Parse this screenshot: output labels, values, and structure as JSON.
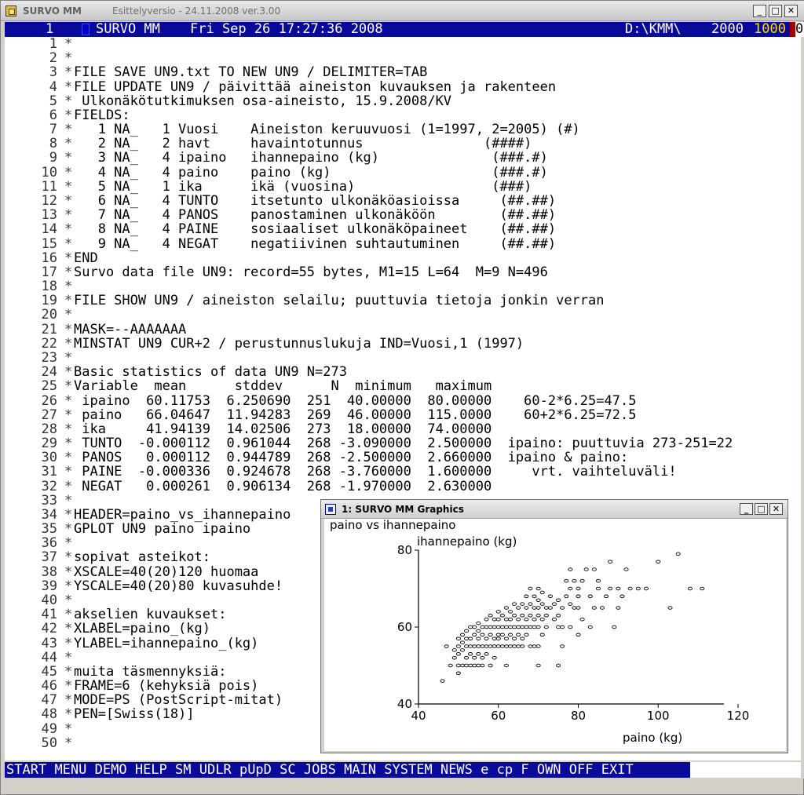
{
  "window": {
    "app_title": "SURVO MM",
    "subtitle": "Esittelyversio  - 24.11.2008 ver.3.00",
    "buttons": [
      "_",
      "□",
      "✕"
    ]
  },
  "status": {
    "line": "1",
    "program": "SURVO MM",
    "datetime": "Fri Sep 26 17:27:36 2008",
    "path": "D:\\KMM\\",
    "num1": "2000",
    "num2": "1000",
    "last": "0"
  },
  "lines": [
    {
      "n": "1",
      "c": "*",
      "t": ""
    },
    {
      "n": "2",
      "c": "*",
      "t": ""
    },
    {
      "n": "3",
      "c": "*",
      "t": "FILE SAVE UN9.txt TO NEW UN9 / DELIMITER=TAB"
    },
    {
      "n": "4",
      "c": "*",
      "t": "FILE UPDATE UN9 / päivittää aineiston kuvauksen ja rakenteen"
    },
    {
      "n": "5",
      "c": "*",
      "t": " Ulkonäkötutkimuksen osa-aineisto, 15.9.2008/KV"
    },
    {
      "n": "6",
      "c": "*",
      "t": "FIELDS:"
    },
    {
      "n": "7",
      "c": "*",
      "t": "   1 NA_   1 Vuosi    Aineiston keruuvuosi (1=1997, 2=2005) (#)"
    },
    {
      "n": "8",
      "c": "*",
      "t": "   2 NA_   2 havt     havaintotunnus               (####)"
    },
    {
      "n": "9",
      "c": "*",
      "t": "   3 NA_   4 ipaino   ihannepaino (kg)              (###.#)"
    },
    {
      "n": "10",
      "c": "*",
      "t": "   4 NA_   4 paino    paino (kg)                    (###.#)"
    },
    {
      "n": "11",
      "c": "*",
      "t": "   5 NA_   1 ika      ikä (vuosina)                 (###)"
    },
    {
      "n": "12",
      "c": "*",
      "t": "   6 NA_   4 TUNTO    itsetunto ulkonäköasioissa     (##.##)"
    },
    {
      "n": "13",
      "c": "*",
      "t": "   7 NA_   4 PANOS    panostaminen ulkonäköön        (##.##)"
    },
    {
      "n": "14",
      "c": "*",
      "t": "   8 NA_   4 PAINE    sosiaaliset ulkonäköpaineet    (##.##)"
    },
    {
      "n": "15",
      "c": "*",
      "t": "   9 NA_   4 NEGAT    negatiivinen suhtautuminen     (##.##)"
    },
    {
      "n": "16",
      "c": "*",
      "t": "END"
    },
    {
      "n": "17",
      "c": "*",
      "t": "Survo data file UN9: record=55 bytes, M1=15 L=64  M=9 N=496"
    },
    {
      "n": "18",
      "c": "*",
      "t": ""
    },
    {
      "n": "19",
      "c": "*",
      "t": "FILE SHOW UN9 / aineiston selailu; puuttuvia tietoja jonkin verran"
    },
    {
      "n": "20",
      "c": "*",
      "t": ""
    },
    {
      "n": "21",
      "c": "*",
      "t": "MASK=--AAAAAAA"
    },
    {
      "n": "22",
      "c": "*",
      "t": "MINSTAT UN9 CUR+2 / perustunnuslukuja IND=Vuosi,1 (1997)"
    },
    {
      "n": "23",
      "c": "*",
      "t": ""
    },
    {
      "n": "24",
      "c": "*",
      "t": "Basic statistics of data UN9 N=273"
    },
    {
      "n": "25",
      "c": "*",
      "t": "Variable  mean      stddev      N  minimum   maximum"
    },
    {
      "n": "26",
      "c": "*",
      "t": " ipaino  60.11753  6.250690  251  40.00000  80.00000    60-2*6.25=47.5"
    },
    {
      "n": "27",
      "c": "*",
      "t": " paino   66.04647  11.94283  269  46.00000  115.0000    60+2*6.25=72.5"
    },
    {
      "n": "28",
      "c": "*",
      "t": " ika     41.94139  14.02506  273  18.00000  74.00000"
    },
    {
      "n": "29",
      "c": "*",
      "t": " TUNTO  -0.000112  0.961044  268 -3.090000  2.500000  ipaino: puuttuvia 273-251=22"
    },
    {
      "n": "30",
      "c": "*",
      "t": " PANOS   0.000112  0.944789  268 -2.500000  2.660000  ipaino & paino:"
    },
    {
      "n": "31",
      "c": "*",
      "t": " PAINE  -0.000336  0.924678  268 -3.760000  1.600000     vrt. vaihteluväli!"
    },
    {
      "n": "32",
      "c": "*",
      "t": " NEGAT   0.000261  0.906134  268 -1.970000  2.630000"
    },
    {
      "n": "33",
      "c": "*",
      "t": ""
    },
    {
      "n": "34",
      "c": "*",
      "t": "HEADER=paino_vs_ihannepaino"
    },
    {
      "n": "35",
      "c": "*",
      "t": "GPLOT UN9 paino ipaino"
    },
    {
      "n": "36",
      "c": "*",
      "t": ""
    },
    {
      "n": "37",
      "c": "*",
      "t": "sopivat asteikot:"
    },
    {
      "n": "38",
      "c": "*",
      "t": "XSCALE=40(20)120 huomaa"
    },
    {
      "n": "39",
      "c": "*",
      "t": "YSCALE=40(20)80 kuvasuhde!"
    },
    {
      "n": "40",
      "c": "*",
      "t": ""
    },
    {
      "n": "41",
      "c": "*",
      "t": "akselien kuvaukset:"
    },
    {
      "n": "42",
      "c": "*",
      "t": "XLABEL=paino_(kg)"
    },
    {
      "n": "43",
      "c": "*",
      "t": "YLABEL=ihannepaino_(kg)"
    },
    {
      "n": "44",
      "c": "*",
      "t": ""
    },
    {
      "n": "45",
      "c": "*",
      "t": "muita täsmennyksiä:"
    },
    {
      "n": "46",
      "c": "*",
      "t": "FRAME=6 (kehyksiä pois)"
    },
    {
      "n": "47",
      "c": "*",
      "t": "MODE=PS (PostScript-mitat)"
    },
    {
      "n": "48",
      "c": "*",
      "t": "PEN=[Swiss(18)]"
    },
    {
      "n": "49",
      "c": "*",
      "t": ""
    },
    {
      "n": "50",
      "c": "*",
      "t": ""
    }
  ],
  "keys": [
    "START",
    "MENU",
    "DEMO",
    "HELP",
    "SM",
    "UDLR",
    "pUpD",
    "SC",
    "JOBS",
    "MAIN",
    "SYSTEM",
    "NEWS",
    "e",
    "cp",
    "F",
    "OWN",
    "OFF",
    "EXIT"
  ],
  "graphics_window": {
    "title": "1: SURVO MM  Graphics",
    "buttons": [
      "_",
      "□",
      "✕"
    ]
  },
  "chart_data": {
    "type": "scatter",
    "title": "paino vs ihannepaino",
    "xlabel": "paino (kg)",
    "ylabel": "ihannepaino (kg)",
    "xlim": [
      40,
      120
    ],
    "ylim": [
      40,
      80
    ],
    "xticks": [
      "40",
      "60",
      "80",
      "100",
      "120"
    ],
    "yticks": [
      "40",
      "60",
      "80"
    ],
    "grid": false,
    "points": [
      [
        46,
        46
      ],
      [
        47,
        55
      ],
      [
        48,
        50
      ],
      [
        49,
        52
      ],
      [
        49,
        54
      ],
      [
        50,
        48
      ],
      [
        50,
        50
      ],
      [
        50,
        53
      ],
      [
        50,
        55
      ],
      [
        50,
        57
      ],
      [
        51,
        50
      ],
      [
        51,
        54
      ],
      [
        51,
        56
      ],
      [
        51,
        58
      ],
      [
        52,
        50
      ],
      [
        52,
        52
      ],
      [
        52,
        55
      ],
      [
        52,
        57
      ],
      [
        52,
        59
      ],
      [
        53,
        50
      ],
      [
        53,
        53
      ],
      [
        53,
        55
      ],
      [
        53,
        57
      ],
      [
        53,
        60
      ],
      [
        54,
        50
      ],
      [
        54,
        52
      ],
      [
        54,
        55
      ],
      [
        54,
        58
      ],
      [
        54,
        60
      ],
      [
        55,
        50
      ],
      [
        55,
        53
      ],
      [
        55,
        55
      ],
      [
        55,
        57
      ],
      [
        55,
        59
      ],
      [
        55,
        61
      ],
      [
        56,
        50
      ],
      [
        56,
        52
      ],
      [
        56,
        55
      ],
      [
        56,
        58
      ],
      [
        56,
        60
      ],
      [
        57,
        53
      ],
      [
        57,
        55
      ],
      [
        57,
        57
      ],
      [
        57,
        60
      ],
      [
        57,
        62
      ],
      [
        58,
        50
      ],
      [
        58,
        55
      ],
      [
        58,
        58
      ],
      [
        58,
        60
      ],
      [
        58,
        63
      ],
      [
        59,
        52
      ],
      [
        59,
        55
      ],
      [
        59,
        57
      ],
      [
        59,
        60
      ],
      [
        59,
        62
      ],
      [
        60,
        55
      ],
      [
        60,
        57
      ],
      [
        60,
        58
      ],
      [
        60,
        60
      ],
      [
        60,
        62
      ],
      [
        60,
        64
      ],
      [
        61,
        55
      ],
      [
        61,
        58
      ],
      [
        61,
        60
      ],
      [
        61,
        63
      ],
      [
        62,
        50
      ],
      [
        62,
        55
      ],
      [
        62,
        57
      ],
      [
        62,
        60
      ],
      [
        62,
        62
      ],
      [
        62,
        65
      ],
      [
        63,
        55
      ],
      [
        63,
        58
      ],
      [
        63,
        60
      ],
      [
        63,
        62
      ],
      [
        63,
        64
      ],
      [
        64,
        55
      ],
      [
        64,
        57
      ],
      [
        64,
        60
      ],
      [
        64,
        63
      ],
      [
        64,
        66
      ],
      [
        65,
        55
      ],
      [
        65,
        58
      ],
      [
        65,
        60
      ],
      [
        65,
        62
      ],
      [
        65,
        65
      ],
      [
        66,
        55
      ],
      [
        66,
        57
      ],
      [
        66,
        60
      ],
      [
        66,
        63
      ],
      [
        66,
        66
      ],
      [
        67,
        58
      ],
      [
        67,
        60
      ],
      [
        67,
        62
      ],
      [
        67,
        65
      ],
      [
        67,
        68
      ],
      [
        68,
        55
      ],
      [
        68,
        60
      ],
      [
        68,
        63
      ],
      [
        68,
        66
      ],
      [
        68,
        70
      ],
      [
        69,
        55
      ],
      [
        69,
        60
      ],
      [
        69,
        62
      ],
      [
        69,
        65
      ],
      [
        69,
        68
      ],
      [
        70,
        50
      ],
      [
        70,
        55
      ],
      [
        70,
        60
      ],
      [
        70,
        63
      ],
      [
        70,
        65
      ],
      [
        70,
        67
      ],
      [
        70,
        70
      ],
      [
        71,
        58
      ],
      [
        71,
        62
      ],
      [
        71,
        66
      ],
      [
        71,
        69
      ],
      [
        72,
        60
      ],
      [
        72,
        63
      ],
      [
        72,
        65
      ],
      [
        73,
        65
      ],
      [
        73,
        68
      ],
      [
        74,
        62
      ],
      [
        74,
        66
      ],
      [
        75,
        50
      ],
      [
        75,
        60
      ],
      [
        75,
        63
      ],
      [
        75,
        67
      ],
      [
        76,
        55
      ],
      [
        76,
        60
      ],
      [
        76,
        65
      ],
      [
        77,
        68
      ],
      [
        77,
        72
      ],
      [
        78,
        60
      ],
      [
        78,
        66
      ],
      [
        78,
        70
      ],
      [
        78,
        75
      ],
      [
        79,
        65
      ],
      [
        79,
        72
      ],
      [
        80,
        58
      ],
      [
        80,
        65
      ],
      [
        80,
        68
      ],
      [
        80,
        70
      ],
      [
        81,
        62
      ],
      [
        81,
        72
      ],
      [
        82,
        75
      ],
      [
        83,
        60
      ],
      [
        83,
        68
      ],
      [
        84,
        65
      ],
      [
        84,
        75
      ],
      [
        85,
        70
      ],
      [
        85,
        72
      ],
      [
        86,
        65
      ],
      [
        87,
        68
      ],
      [
        88,
        70
      ],
      [
        88,
        77
      ],
      [
        89,
        60
      ],
      [
        90,
        65
      ],
      [
        90,
        70
      ],
      [
        91,
        68
      ],
      [
        92,
        75
      ],
      [
        93,
        70
      ],
      [
        95,
        70
      ],
      [
        97,
        70
      ],
      [
        100,
        77
      ],
      [
        103,
        65
      ],
      [
        105,
        79
      ],
      [
        108,
        70
      ],
      [
        111,
        70
      ]
    ]
  }
}
